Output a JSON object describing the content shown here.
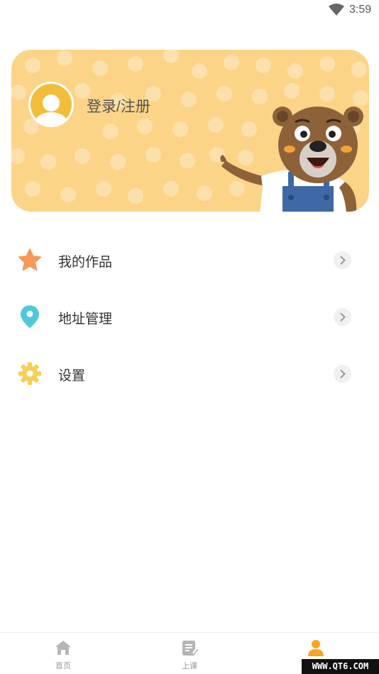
{
  "status_bar": {
    "time": "3:59",
    "wifi_icon": "wifi-icon"
  },
  "profile": {
    "login_label": "登录/注册",
    "avatar_icon": "user-avatar-icon",
    "card_color": "#fcd488"
  },
  "menu": {
    "items": [
      {
        "label": "我的作品",
        "icon": "star-icon",
        "color": "#f59a5a"
      },
      {
        "label": "地址管理",
        "icon": "location-pin-icon",
        "color": "#4dc9d9"
      },
      {
        "label": "设置",
        "icon": "gear-icon",
        "color": "#f7cf55"
      }
    ]
  },
  "tab_bar": {
    "tabs": [
      {
        "label": "首页",
        "icon": "home-icon",
        "active": false
      },
      {
        "label": "上课",
        "icon": "notebook-icon",
        "active": false
      },
      {
        "label": "",
        "icon": "person-icon",
        "active": true
      }
    ],
    "active_color": "#f5a623",
    "inactive_color": "#b5b5b5"
  },
  "watermark": "WWW.QT6.COM"
}
